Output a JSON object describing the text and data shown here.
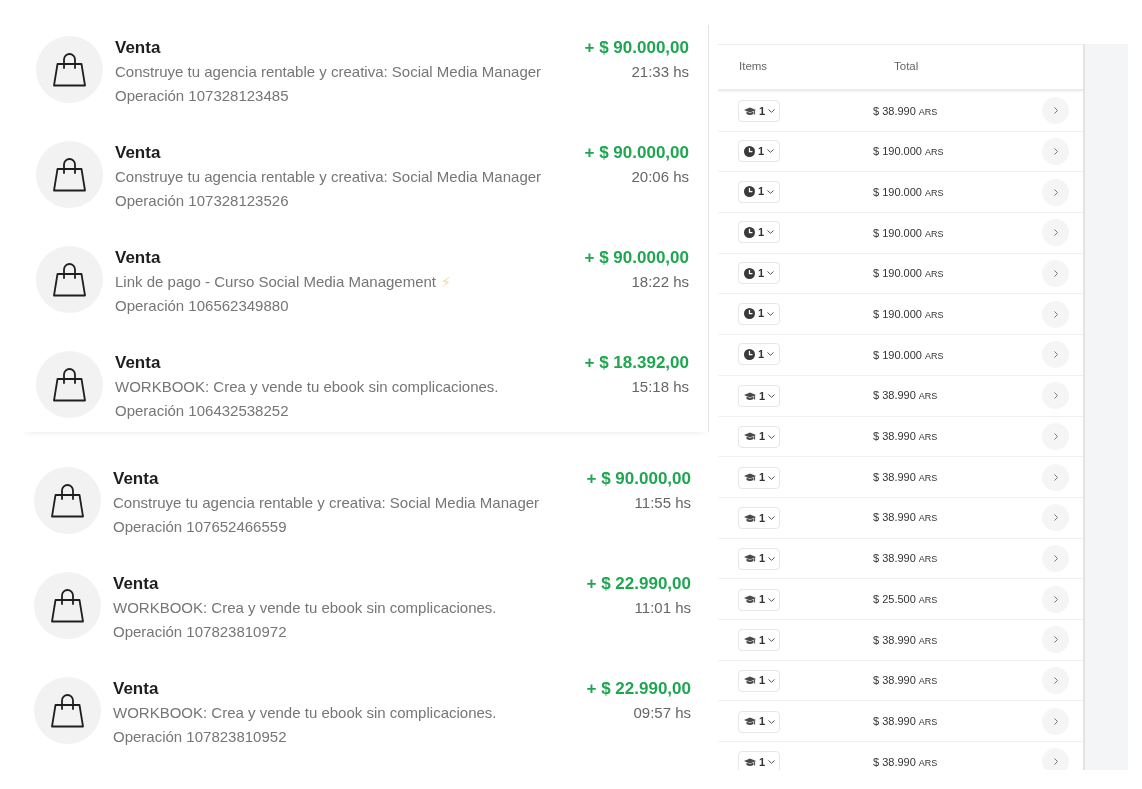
{
  "sales_panels": [
    {
      "items": [
        {
          "title": "Venta",
          "description": "Construye tu agencia rentable y creativa: Social Media Manager",
          "operation": "Operación 107328123485",
          "amount": "+ $ 90.000,00",
          "time": "21:33 hs"
        },
        {
          "title": "Venta",
          "description": "Construye tu agencia rentable y creativa: Social Media Manager",
          "operation": "Operación 107328123526",
          "amount": "+ $ 90.000,00",
          "time": "20:06 hs"
        },
        {
          "title": "Venta",
          "description": "Link de pago - Curso Social Media Management",
          "emoji": "⚡",
          "operation": "Operación 106562349880",
          "amount": "+ $ 90.000,00",
          "time": "18:22 hs"
        },
        {
          "title": "Venta",
          "description": "WORKBOOK: Crea y vende tu ebook sin complicaciones.",
          "operation": "Operación 106432538252",
          "amount": "+ $ 18.392,00",
          "time": "15:18 hs"
        }
      ]
    },
    {
      "items": [
        {
          "title": "Venta",
          "description": "Construye tu agencia rentable y creativa: Social Media Manager",
          "operation": "Operación 107652466559",
          "amount": "+ $ 90.000,00",
          "time": "11:55 hs"
        },
        {
          "title": "Venta",
          "description": "WORKBOOK: Crea y vende tu ebook sin complicaciones.",
          "operation": "Operación 107823810972",
          "amount": "+ $ 22.990,00",
          "time": "11:01 hs"
        },
        {
          "title": "Venta",
          "description": "WORKBOOK: Crea y vende tu ebook sin complicaciones.",
          "operation": "Operación 107823810952",
          "amount": "+ $ 22.990,00",
          "time": "09:57 hs"
        }
      ]
    }
  ],
  "orders_table": {
    "columns": [
      "Items",
      "Total"
    ],
    "rows": [
      {
        "kind": "course",
        "quantity": "1",
        "total": "$ 38.990",
        "currency": "ARS"
      },
      {
        "kind": "clock",
        "quantity": "1",
        "total": "$ 190.000",
        "currency": "ARS"
      },
      {
        "kind": "clock",
        "quantity": "1",
        "total": "$ 190.000",
        "currency": "ARS"
      },
      {
        "kind": "clock",
        "quantity": "1",
        "total": "$ 190.000",
        "currency": "ARS"
      },
      {
        "kind": "clock",
        "quantity": "1",
        "total": "$ 190.000",
        "currency": "ARS"
      },
      {
        "kind": "clock",
        "quantity": "1",
        "total": "$ 190.000",
        "currency": "ARS"
      },
      {
        "kind": "clock",
        "quantity": "1",
        "total": "$ 190.000",
        "currency": "ARS"
      },
      {
        "kind": "course",
        "quantity": "1",
        "total": "$ 38.990",
        "currency": "ARS"
      },
      {
        "kind": "course",
        "quantity": "1",
        "total": "$ 38.990",
        "currency": "ARS"
      },
      {
        "kind": "course",
        "quantity": "1",
        "total": "$ 38.990",
        "currency": "ARS"
      },
      {
        "kind": "course",
        "quantity": "1",
        "total": "$ 38.990",
        "currency": "ARS"
      },
      {
        "kind": "course",
        "quantity": "1",
        "total": "$ 38.990",
        "currency": "ARS"
      },
      {
        "kind": "course",
        "quantity": "1",
        "total": "$ 25.500",
        "currency": "ARS"
      },
      {
        "kind": "course",
        "quantity": "1",
        "total": "$ 38.990",
        "currency": "ARS"
      },
      {
        "kind": "course",
        "quantity": "1",
        "total": "$ 38.990",
        "currency": "ARS"
      },
      {
        "kind": "course",
        "quantity": "1",
        "total": "$ 38.990",
        "currency": "ARS"
      },
      {
        "kind": "course",
        "quantity": "1",
        "total": "$ 38.990",
        "currency": "ARS"
      }
    ]
  }
}
